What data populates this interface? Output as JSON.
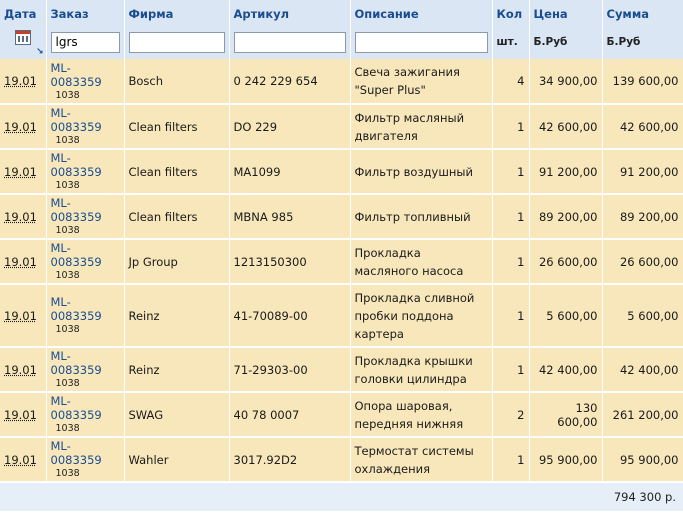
{
  "headers": {
    "date": "Дата",
    "order": "Заказ",
    "firm": "Фирма",
    "article": "Артикул",
    "description": "Описание",
    "qty": "Кол",
    "price": "Цена",
    "sum": "Сумма"
  },
  "subheaders": {
    "qty_unit": "шт.",
    "price_unit": "Б.Руб",
    "sum_unit": "Б.Руб"
  },
  "filters": {
    "order": "lgrs",
    "firm": "",
    "article": "",
    "description": ""
  },
  "rows": [
    {
      "date": "19.01",
      "order": "ML-0083359",
      "order_sub": "1038",
      "firm": "Bosch",
      "article": "0 242 229 654",
      "description": "Свеча зажигания \"Super Plus\"",
      "qty": "4",
      "price": "34 900,00",
      "sum": "139 600,00"
    },
    {
      "date": "19.01",
      "order": "ML-0083359",
      "order_sub": "1038",
      "firm": "Clean filters",
      "article": "DO 229",
      "description": "Фильтр масляный двигателя",
      "qty": "1",
      "price": "42 600,00",
      "sum": "42 600,00"
    },
    {
      "date": "19.01",
      "order": "ML-0083359",
      "order_sub": "1038",
      "firm": "Clean filters",
      "article": "MA1099",
      "description": "Фильтр воздушный",
      "qty": "1",
      "price": "91 200,00",
      "sum": "91 200,00"
    },
    {
      "date": "19.01",
      "order": "ML-0083359",
      "order_sub": "1038",
      "firm": "Clean filters",
      "article": "MBNA 985",
      "description": "Фильтр топливный",
      "qty": "1",
      "price": "89 200,00",
      "sum": "89 200,00"
    },
    {
      "date": "19.01",
      "order": "ML-0083359",
      "order_sub": "1038",
      "firm": "Jp Group",
      "article": "1213150300",
      "description": "Прокладка масляного насоса",
      "qty": "1",
      "price": "26 600,00",
      "sum": "26 600,00"
    },
    {
      "date": "19.01",
      "order": "ML-0083359",
      "order_sub": "1038",
      "firm": "Reinz",
      "article": "41-70089-00",
      "description": "Прокладка сливной пробки поддона картера",
      "qty": "1",
      "price": "5 600,00",
      "sum": "5 600,00"
    },
    {
      "date": "19.01",
      "order": "ML-0083359",
      "order_sub": "1038",
      "firm": "Reinz",
      "article": "71-29303-00",
      "description": "Прокладка крышки головки цилиндра",
      "qty": "1",
      "price": "42 400,00",
      "sum": "42 400,00"
    },
    {
      "date": "19.01",
      "order": "ML-0083359",
      "order_sub": "1038",
      "firm": "SWAG",
      "article": "40 78 0007",
      "description": "Опора шаровая, передняя нижняя",
      "qty": "2",
      "price": "130 600,00",
      "sum": "261 200,00"
    },
    {
      "date": "19.01",
      "order": "ML-0083359",
      "order_sub": "1038",
      "firm": "Wahler",
      "article": "3017.92D2",
      "description": "Термостат системы охлаждения",
      "qty": "1",
      "price": "95 900,00",
      "sum": "95 900,00"
    }
  ],
  "total": "794 300 р.",
  "icons": {
    "date_filter": "calendar-icon",
    "sort": "sort-arrow-icon"
  }
}
